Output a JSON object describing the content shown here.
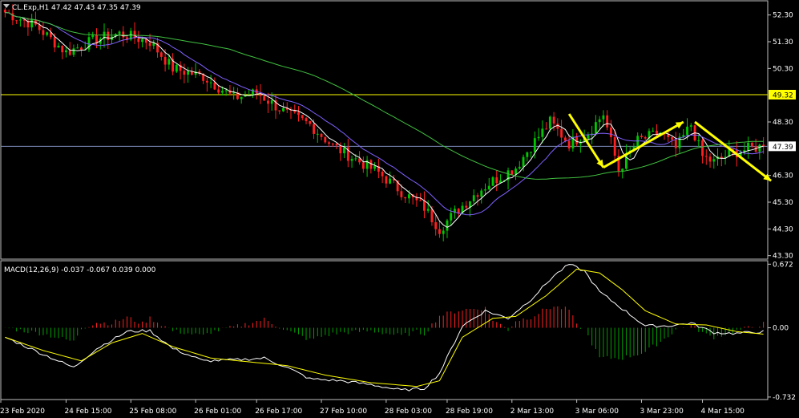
{
  "header": {
    "symbol_tf": "CL.Exp,H1",
    "ohlc": "47.42 47.43 47.35 47.39",
    "macd_label": "MACD(12,26,9) -0.037 -0.067 0.039 0.000"
  },
  "colors": {
    "background": "#000000",
    "frame": "#c0c0c0",
    "bull": "#00c800",
    "bear": "#ff2020",
    "ma_fast": "#ffffff",
    "ma_mid": "#8060ff",
    "ma_slow": "#40c040",
    "resistance": "#ffff00",
    "current_line": "#8090c0",
    "arrows": "#ffff00",
    "macd_hist_pos": "#ff2020",
    "macd_hist_neg": "#00a000",
    "macd_line": "#ffffff",
    "signal_line": "#ffff00"
  },
  "chart_data": {
    "type": "candlestick",
    "price_axis": {
      "range": [
        43.2,
        52.8
      ],
      "ticks": [
        "52.30",
        "51.30",
        "50.30",
        "48.30",
        "46.30",
        "45.30",
        "44.30",
        "43.30"
      ],
      "tick_values": [
        52.3,
        51.3,
        50.3,
        48.3,
        46.3,
        45.3,
        44.3,
        43.3
      ]
    },
    "horizontal_levels": [
      {
        "label": "49.32",
        "value": 49.32,
        "style": "resistance"
      },
      {
        "label": "47.39",
        "value": 47.39,
        "style": "current"
      }
    ],
    "time_axis": {
      "labels": [
        "23 Feb 2020",
        "24 Feb 15:00",
        "25 Feb 08:00",
        "26 Feb 01:00",
        "26 Feb 17:00",
        "27 Feb 10:00",
        "28 Feb 03:00",
        "28 Feb 19:00",
        "2 Mar 13:00",
        "3 Mar 06:00",
        "3 Mar 23:00",
        "4 Mar 15:00"
      ],
      "bar_index": [
        0,
        16,
        33,
        50,
        66,
        83,
        100,
        116,
        133,
        150,
        167,
        183
      ]
    },
    "bar_count": 200,
    "close_path": [
      [
        0,
        52.4
      ],
      [
        8,
        51.9
      ],
      [
        16,
        50.9
      ],
      [
        24,
        51.4
      ],
      [
        30,
        51.6
      ],
      [
        38,
        51.3
      ],
      [
        44,
        50.3
      ],
      [
        52,
        50.0
      ],
      [
        60,
        49.2
      ],
      [
        66,
        49.4
      ],
      [
        74,
        48.6
      ],
      [
        80,
        48.2
      ],
      [
        86,
        47.4
      ],
      [
        92,
        46.9
      ],
      [
        98,
        46.4
      ],
      [
        104,
        45.7
      ],
      [
        110,
        45.1
      ],
      [
        114,
        44.3
      ],
      [
        118,
        44.9
      ],
      [
        124,
        45.7
      ],
      [
        128,
        46.1
      ],
      [
        134,
        46.6
      ],
      [
        138,
        47.4
      ],
      [
        143,
        48.3
      ],
      [
        148,
        47.5
      ],
      [
        153,
        47.9
      ],
      [
        157,
        48.6
      ],
      [
        161,
        46.5
      ],
      [
        166,
        47.6
      ],
      [
        172,
        47.9
      ],
      [
        176,
        47.3
      ],
      [
        180,
        48.2
      ],
      [
        183,
        47.0
      ],
      [
        186,
        46.8
      ],
      [
        190,
        47.1
      ],
      [
        195,
        47.3
      ],
      [
        199,
        47.39
      ]
    ],
    "macd_axis": {
      "range": [
        -0.75,
        0.7
      ],
      "ticks": [
        "0.672",
        "0.00",
        "-0.732"
      ],
      "tick_values": [
        0.672,
        0.0,
        -0.732
      ]
    },
    "macd_path": [
      [
        0,
        -0.1
      ],
      [
        10,
        -0.28
      ],
      [
        18,
        -0.42
      ],
      [
        24,
        -0.22
      ],
      [
        32,
        -0.04
      ],
      [
        38,
        -0.03
      ],
      [
        44,
        -0.22
      ],
      [
        52,
        -0.35
      ],
      [
        60,
        -0.34
      ],
      [
        68,
        -0.32
      ],
      [
        74,
        -0.42
      ],
      [
        80,
        -0.54
      ],
      [
        88,
        -0.56
      ],
      [
        96,
        -0.6
      ],
      [
        104,
        -0.66
      ],
      [
        110,
        -0.64
      ],
      [
        114,
        -0.48
      ],
      [
        120,
        0.02
      ],
      [
        126,
        0.18
      ],
      [
        132,
        0.1
      ],
      [
        138,
        0.3
      ],
      [
        144,
        0.55
      ],
      [
        148,
        0.67
      ],
      [
        152,
        0.6
      ],
      [
        156,
        0.38
      ],
      [
        162,
        0.2
      ],
      [
        168,
        0.02
      ],
      [
        174,
        0.02
      ],
      [
        180,
        0.05
      ],
      [
        186,
        -0.05
      ],
      [
        192,
        -0.06
      ],
      [
        199,
        -0.04
      ]
    ],
    "signal_path": [
      [
        0,
        -0.1
      ],
      [
        10,
        -0.24
      ],
      [
        20,
        -0.35
      ],
      [
        28,
        -0.16
      ],
      [
        36,
        -0.06
      ],
      [
        44,
        -0.2
      ],
      [
        54,
        -0.32
      ],
      [
        64,
        -0.36
      ],
      [
        74,
        -0.4
      ],
      [
        84,
        -0.5
      ],
      [
        96,
        -0.58
      ],
      [
        108,
        -0.62
      ],
      [
        114,
        -0.56
      ],
      [
        120,
        -0.1
      ],
      [
        128,
        0.1
      ],
      [
        134,
        0.12
      ],
      [
        142,
        0.34
      ],
      [
        150,
        0.62
      ],
      [
        156,
        0.58
      ],
      [
        162,
        0.4
      ],
      [
        168,
        0.18
      ],
      [
        176,
        0.04
      ],
      [
        184,
        0.03
      ],
      [
        192,
        -0.04
      ],
      [
        199,
        -0.067
      ]
    ],
    "arrows": [
      {
        "from": [
          148,
          48.6
        ],
        "to": [
          157,
          46.6
        ]
      },
      {
        "from": [
          157,
          46.6
        ],
        "to": [
          178,
          48.3
        ]
      },
      {
        "from": [
          181,
          48.3
        ],
        "to": [
          201,
          46.1
        ]
      }
    ]
  }
}
